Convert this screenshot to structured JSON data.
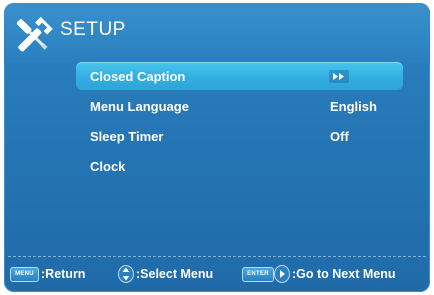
{
  "header": {
    "title": "SETUP",
    "icon": "tools-icon"
  },
  "menu": {
    "items": [
      {
        "label": "Closed Caption",
        "value": "",
        "value_icon": "double-arrow-right-icon",
        "selected": true
      },
      {
        "label": "Menu Language",
        "value": "English",
        "selected": false
      },
      {
        "label": "Sleep Timer",
        "value": "Off",
        "selected": false
      },
      {
        "label": "Clock",
        "value": "",
        "selected": false
      }
    ]
  },
  "footer": {
    "menu_key": "MENU",
    "return_text": ":Return",
    "select_text": ":Select Menu",
    "enter_key": "ENTER",
    "next_text": ":Go to Next Menu"
  },
  "colors": {
    "background": "#2677b6",
    "highlight": "#3aaee0",
    "text": "#ffffff"
  }
}
